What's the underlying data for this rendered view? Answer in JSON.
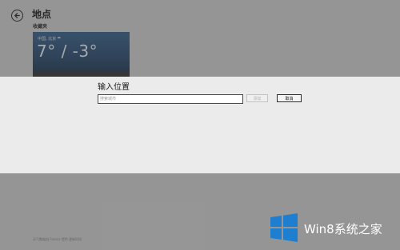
{
  "app": {
    "title": "地点",
    "section_title": "收藏夹"
  },
  "weather_tile": {
    "city": "中国, 北京",
    "icon": "weather-icon",
    "temperature": "7° / -3°",
    "color": "#2f5b86"
  },
  "dialog": {
    "title": "输入位置",
    "input_placeholder": "搜索城市",
    "input_value": "",
    "add_label": "添加",
    "cancel_label": "取消"
  },
  "footer": {
    "text": "天气数据由 Foreca 提供  更新时间"
  },
  "watermark": {
    "text": "Win8系统之家",
    "logo_color": "#1e7fd0"
  },
  "icons": {
    "back": "back-arrow-icon",
    "logo": "windows-logo-icon"
  }
}
